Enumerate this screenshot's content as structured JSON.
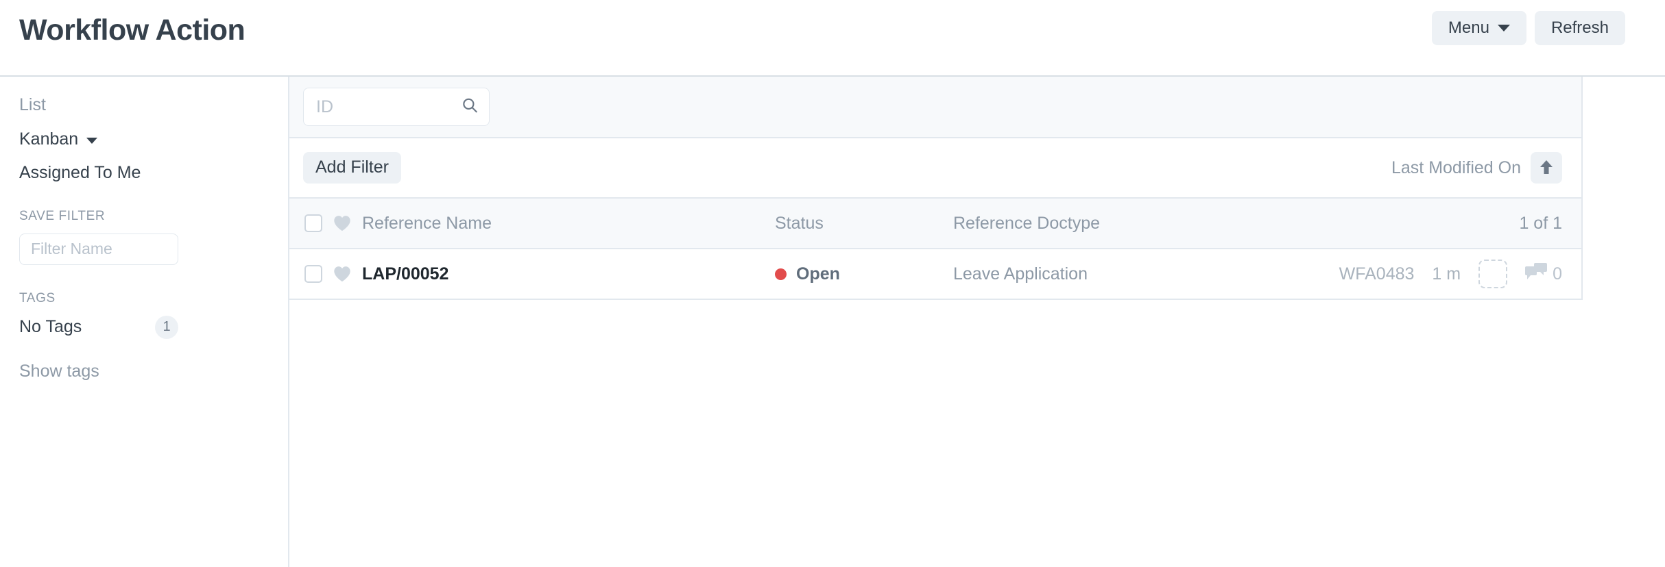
{
  "header": {
    "title": "Workflow Action",
    "menu_label": "Menu",
    "refresh_label": "Refresh"
  },
  "sidebar": {
    "view_label": "List",
    "kanban_label": "Kanban",
    "assigned_label": "Assigned To Me",
    "save_filter_title": "SAVE FILTER",
    "filter_name_placeholder": "Filter Name",
    "filter_name_value": "",
    "tags_title": "TAGS",
    "no_tags_label": "No Tags",
    "no_tags_count": "1",
    "show_tags_label": "Show tags"
  },
  "toolbar": {
    "id_placeholder": "ID",
    "id_value": "",
    "add_filter_label": "Add Filter",
    "sort_label": "Last Modified On",
    "sort_direction": "asc"
  },
  "list": {
    "columns": {
      "reference_name": "Reference Name",
      "status": "Status",
      "reference_doctype": "Reference Doctype"
    },
    "result_count": "1 of 1",
    "rows": [
      {
        "reference_name": "LAP/00052",
        "status": "Open",
        "status_color": "#e24c4c",
        "reference_doctype": "Leave Application",
        "workflow_id": "WFA0483",
        "modified": "1 m",
        "comment_count": "0"
      }
    ]
  },
  "colors": {
    "accent_muted": "#8d99a6",
    "text": "#36414c",
    "button_bg": "#edf1f5",
    "border": "#e2e8ee",
    "status_open": "#e24c4c"
  }
}
